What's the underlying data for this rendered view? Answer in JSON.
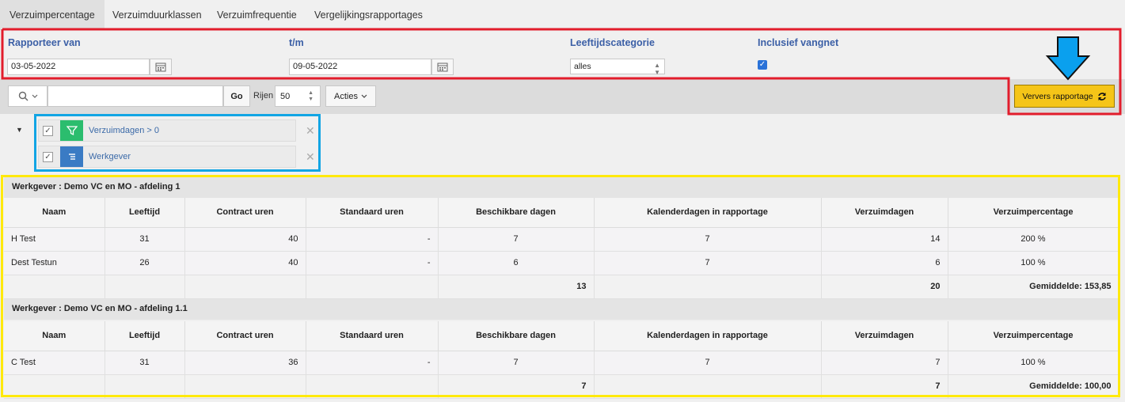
{
  "tabs": [
    "Verzuimpercentage",
    "Verzuimduurklassen",
    "Verzuimfrequentie",
    "Vergelijkingsrapportages"
  ],
  "filters": {
    "rapporteer_van_label": "Rapporteer van",
    "rapporteer_van_value": "03-05-2022",
    "tm_label": "t/m",
    "tm_value": "09-05-2022",
    "leeftijd_label": "Leeftijdscategorie",
    "leeftijd_value": "alles",
    "vangnet_label": "Inclusief vangnet",
    "vangnet_checked": true
  },
  "toolbar": {
    "search_value": "",
    "go_label": "Go",
    "rijen_label": "Rijen",
    "rijen_value": "50",
    "acties_label": "Acties",
    "refresh_label": "Ververs rapportage"
  },
  "active_filters": [
    {
      "label": "Verzuimdagen > 0",
      "icon": "filter-icon",
      "color": "#2bbd6e"
    },
    {
      "label": "Werkgever",
      "icon": "list-icon",
      "color": "#3a7bc4"
    }
  ],
  "columns": [
    "Naam",
    "Leeftijd",
    "Contract uren",
    "Standaard uren",
    "Beschikbare dagen",
    "Kalenderdagen in rapportage",
    "Verzuimdagen",
    "Verzuimpercentage"
  ],
  "groups": [
    {
      "title": "Werkgever : Demo VC en MO - afdeling 1",
      "rows": [
        [
          "H Test",
          "31",
          "40",
          "-",
          "7",
          "7",
          "14",
          "200 %"
        ],
        [
          "Dest Testun",
          "26",
          "40",
          "-",
          "6",
          "7",
          "6",
          "100 %"
        ]
      ],
      "totals": {
        "beschikbare_dagen": "13",
        "verzuimdagen": "20",
        "gemiddelde": "Gemiddelde: 153,85"
      }
    },
    {
      "title": "Werkgever : Demo VC en MO - afdeling 1.1",
      "rows": [
        [
          "C Test",
          "31",
          "36",
          "-",
          "7",
          "7",
          "7",
          "100 %"
        ]
      ],
      "totals": {
        "beschikbare_dagen": "7",
        "verzuimdagen": "7",
        "gemiddelde": "Gemiddelde: 100,00"
      }
    }
  ],
  "colors": {
    "highlight_red": "#e21d2c",
    "highlight_blue": "#12a5e4",
    "highlight_yellow": "#ffe90c",
    "refresh_button": "#f5c518",
    "label_blue": "#3b5fa6"
  }
}
